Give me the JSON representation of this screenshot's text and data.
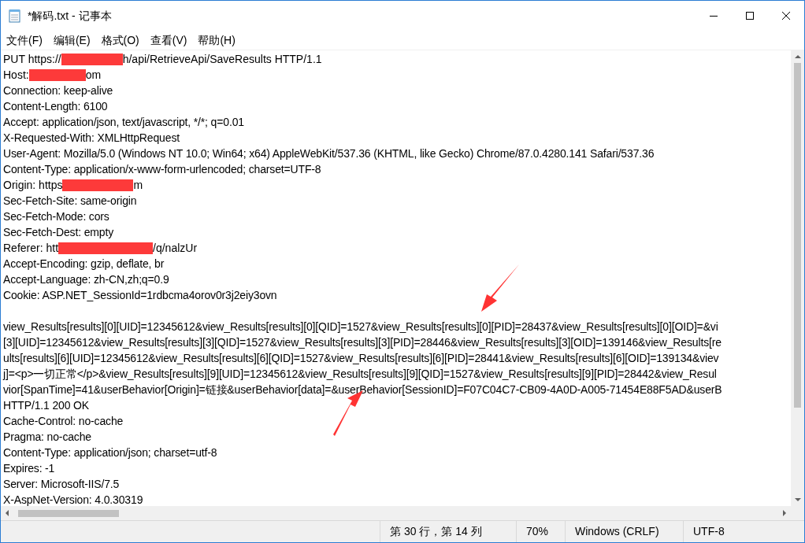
{
  "window": {
    "title": "*解码.txt - 记事本"
  },
  "menu": [
    "文件(F)",
    "编辑(E)",
    "格式(O)",
    "查看(V)",
    "帮助(H)"
  ],
  "lines": [
    {
      "kind": "redacted",
      "before": "PUT https://",
      "after": "h/api/RetrieveApi/SaveResults HTTP/1.1"
    },
    {
      "kind": "redacted",
      "before": "Host: ",
      "after": "om"
    },
    {
      "kind": "text",
      "text": "Connection: keep-alive"
    },
    {
      "kind": "text",
      "text": "Content-Length: 6100"
    },
    {
      "kind": "text",
      "text": "Accept: application/json, text/javascript, */*; q=0.01"
    },
    {
      "kind": "text",
      "text": "X-Requested-With: XMLHttpRequest"
    },
    {
      "kind": "text",
      "text": "User-Agent: Mozilla/5.0 (Windows NT 10.0; Win64; x64) AppleWebKit/537.36 (KHTML, like Gecko) Chrome/87.0.4280.141 Safari/537.36"
    },
    {
      "kind": "text",
      "text": "Content-Type: application/x-www-form-urlencoded; charset=UTF-8"
    },
    {
      "kind": "redacted",
      "before": "Origin: https",
      "after": "m"
    },
    {
      "kind": "text",
      "text": "Sec-Fetch-Site: same-origin"
    },
    {
      "kind": "text",
      "text": "Sec-Fetch-Mode: cors"
    },
    {
      "kind": "text",
      "text": "Sec-Fetch-Dest: empty"
    },
    {
      "kind": "redacted",
      "before": "Referer: htt",
      "after": "/q/nalzUr"
    },
    {
      "kind": "text",
      "text": "Accept-Encoding: gzip, deflate, br"
    },
    {
      "kind": "text",
      "text": "Accept-Language: zh-CN,zh;q=0.9"
    },
    {
      "kind": "text",
      "text": "Cookie: ASP.NET_SessionId=1rdbcma4orov0r3j2eiy3ovn"
    },
    {
      "kind": "blank"
    },
    {
      "kind": "text",
      "text": "view_Results[results][0][UID]=12345612&view_Results[results][0][QID]=1527&view_Results[results][0][PID]=28437&view_Results[results][0][OID]=&vi"
    },
    {
      "kind": "text",
      "text": "[3][UID]=12345612&view_Results[results][3][QID]=1527&view_Results[results][3][PID]=28446&view_Results[results][3][OID]=139146&view_Results[re"
    },
    {
      "kind": "text",
      "text": "ults[results][6][UID]=12345612&view_Results[results][6][QID]=1527&view_Results[results][6][PID]=28441&view_Results[results][6][OID]=139134&viev"
    },
    {
      "kind": "text",
      "text": "j]=<p>一切正常</p>&view_Results[results][9][UID]=12345612&view_Results[results][9][QID]=1527&view_Results[results][9][PID]=28442&view_Resul"
    },
    {
      "kind": "text",
      "text": "vior[SpanTime]=41&userBehavior[Origin]=链接&userBehavior[data]=&userBehavior[SessionID]=F07C04C7-CB09-4A0D-A005-71454E88F5AD&userB"
    },
    {
      "kind": "text",
      "text": "HTTP/1.1 200 OK"
    },
    {
      "kind": "text",
      "text": "Cache-Control: no-cache"
    },
    {
      "kind": "text",
      "text": "Pragma: no-cache"
    },
    {
      "kind": "text",
      "text": "Content-Type: application/json; charset=utf-8"
    },
    {
      "kind": "text",
      "text": "Expires: -1"
    },
    {
      "kind": "text",
      "text": "Server: Microsoft-IIS/7.5"
    },
    {
      "kind": "text",
      "text": "X-AspNet-Version: 4.0.30319"
    }
  ],
  "status_bar": {
    "position": "第 30 行，第 14 列",
    "zoom": "70%",
    "line_ending": "Windows (CRLF)",
    "encoding": "UTF-8"
  }
}
